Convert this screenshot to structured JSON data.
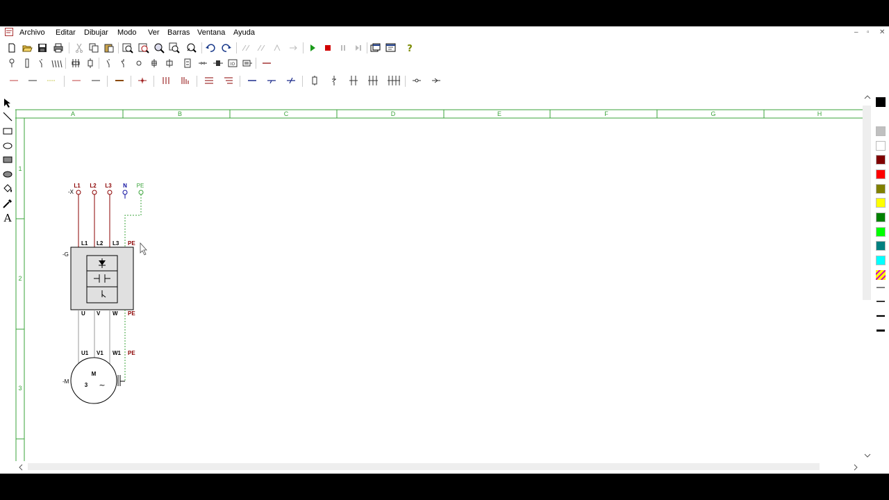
{
  "menu": {
    "items": [
      "Archivo",
      "Editar",
      "Dibujar",
      "Modo",
      "Ver",
      "Barras",
      "Ventana",
      "Ayuda"
    ]
  },
  "window_controls": {
    "minimize": "–",
    "restore": "▫",
    "close": "✕"
  },
  "ruler": {
    "columns": [
      "A",
      "B",
      "C",
      "D",
      "E",
      "F",
      "G",
      "H"
    ],
    "rows": [
      "1",
      "2",
      "3"
    ]
  },
  "schematic": {
    "terminal_ref": "-X",
    "terminals": [
      "L1",
      "L2",
      "L3",
      "N",
      "PE"
    ],
    "drive_ref": "-G",
    "drive_inputs": [
      "L1",
      "L2",
      "L3",
      "PE"
    ],
    "drive_outputs": [
      "U",
      "V",
      "W",
      "PE"
    ],
    "motor_terminals": [
      "U1",
      "V1",
      "W1",
      "PE"
    ],
    "motor_ref": "-M",
    "motor_letter": "M",
    "motor_phases": "3",
    "motor_symbol": "~"
  },
  "left_tools": [
    "select-arrow-icon",
    "line-icon",
    "rectangle-icon",
    "ellipse-icon",
    "filled-rectangle-icon",
    "filled-ellipse-icon",
    "fill-bucket-icon",
    "color-picker-icon",
    "text-icon"
  ],
  "palette_colors": [
    "#000000",
    "#c0c0c0",
    "#ffffff",
    "#800000",
    "#ff0000",
    "#808000",
    "#ffff00",
    "#008000",
    "#00ff00",
    "#008080",
    "#00ffff"
  ],
  "colors": {
    "grid_green": "#3aa33a",
    "wire_red": "#8b0000",
    "wire_pe": "#3aa33a",
    "n_blue": "#1010a0"
  }
}
